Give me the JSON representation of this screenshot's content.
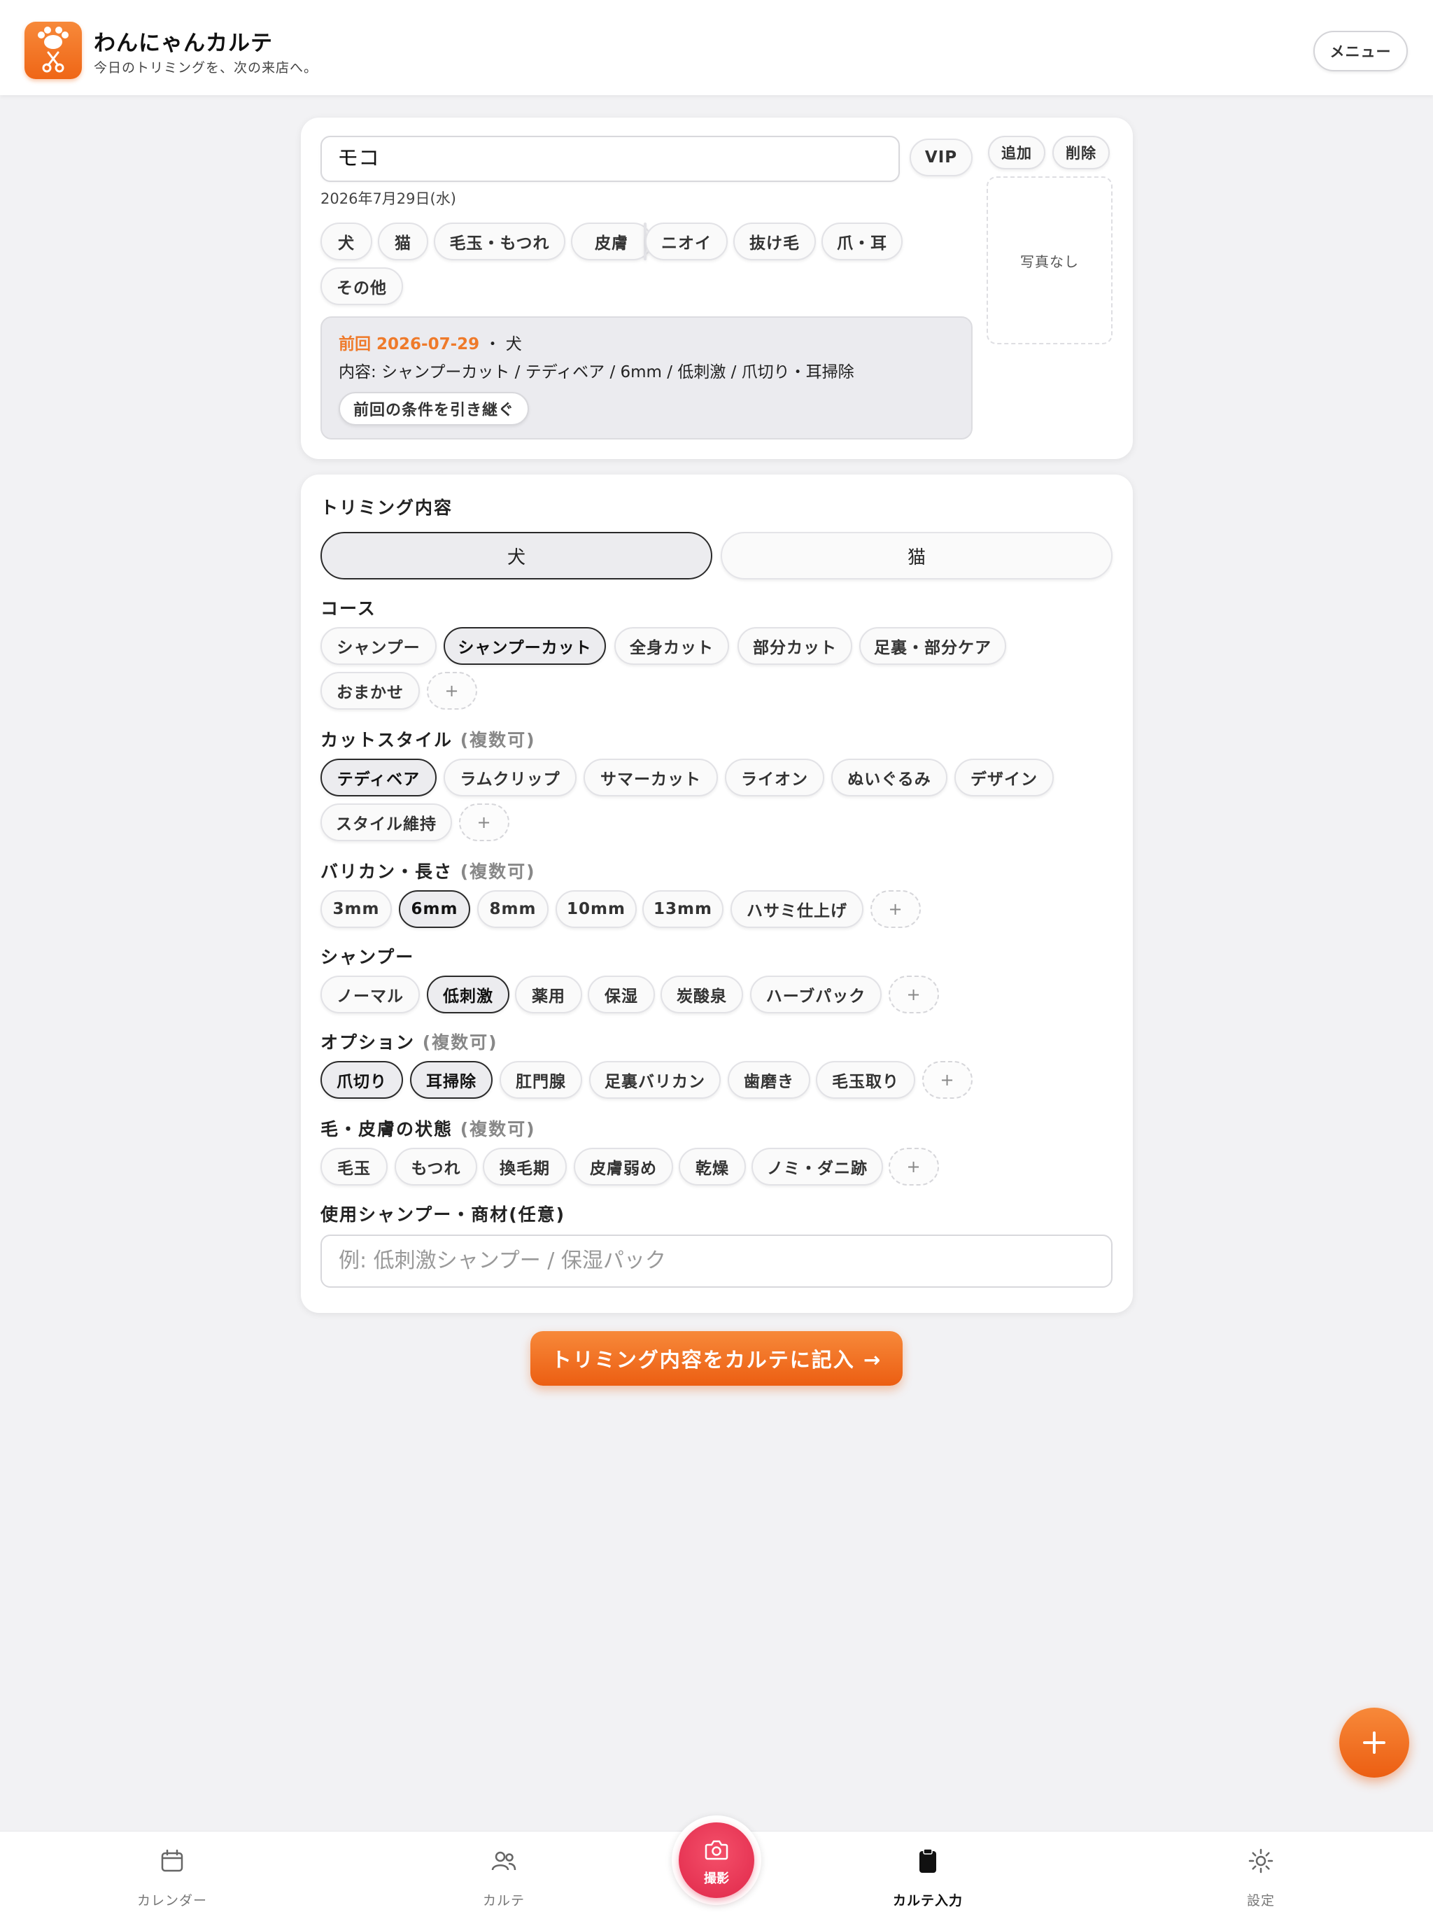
{
  "app": {
    "title": "わんにゃんカルテ",
    "subtitle": "今日のトリミングを、次の来店へ。",
    "menu_label": "メニュー"
  },
  "profile": {
    "name_value": "モコ",
    "vip_label": "VIP",
    "add_label": "追加",
    "delete_label": "削除",
    "date": "2026年7月29日(水)",
    "photo_placeholder": "写真なし",
    "tags": [
      "犬",
      "猫",
      "毛玉・もつれ",
      "皮膚",
      "ニオイ",
      "抜け毛",
      "爪・耳",
      "その他"
    ],
    "previous": {
      "label": "前回 2026-07-29",
      "separator_species": "・ 犬",
      "content": "内容: シャンプーカット / テディベア / 6mm / 低刺激 / 爪切り・耳掃除",
      "inherit_button": "前回の条件を引き継ぐ"
    }
  },
  "trimming": {
    "title": "トリミング内容",
    "type_toggle": {
      "dog": "犬",
      "cat": "猫",
      "selected": "犬"
    },
    "add_symbol": "+",
    "multi_hint": "(複数可)",
    "sections": {
      "course": {
        "title": "コース",
        "options": [
          "シャンプー",
          "シャンプーカット",
          "全身カット",
          "部分カット",
          "足裏・部分ケア",
          "おまかせ"
        ],
        "selected": [
          "シャンプーカット"
        ]
      },
      "cut_style": {
        "title": "カットスタイル",
        "options": [
          "テディベア",
          "ラムクリップ",
          "サマーカット",
          "ライオン",
          "ぬいぐるみ",
          "デザイン",
          "スタイル維持"
        ],
        "selected": [
          "テディベア"
        ]
      },
      "clipper": {
        "title": "バリカン・長さ",
        "options": [
          "3mm",
          "6mm",
          "8mm",
          "10mm",
          "13mm",
          "ハサミ仕上げ"
        ],
        "selected": [
          "6mm"
        ]
      },
      "shampoo": {
        "title": "シャンプー",
        "options": [
          "ノーマル",
          "低刺激",
          "薬用",
          "保湿",
          "炭酸泉",
          "ハーブパック"
        ],
        "selected": [
          "低刺激"
        ]
      },
      "option": {
        "title": "オプション",
        "options": [
          "爪切り",
          "耳掃除",
          "肛門腺",
          "足裏バリカン",
          "歯磨き",
          "毛玉取り"
        ],
        "selected": [
          "爪切り",
          "耳掃除"
        ]
      },
      "condition": {
        "title": "毛・皮膚の状態",
        "options": [
          "毛玉",
          "もつれ",
          "換毛期",
          "皮膚弱め",
          "乾燥",
          "ノミ・ダニ跡"
        ],
        "selected": []
      }
    },
    "product": {
      "title": "使用シャンプー・商材(任意)",
      "placeholder": "例: 低刺激シャンプー / 保湿パック",
      "value": ""
    }
  },
  "cta_label": "トリミング内容をカルテに記入 →",
  "fab_symbol": "+",
  "bottom_nav": {
    "calendar": "カレンダー",
    "karte": "カルテ",
    "camera": "撮影",
    "karte_input": "カルテ入力",
    "settings": "設定",
    "active": "karte_input"
  },
  "colors": {
    "accent": "#ef6616",
    "camera": "#e0284a",
    "background": "#f2f2f4"
  }
}
